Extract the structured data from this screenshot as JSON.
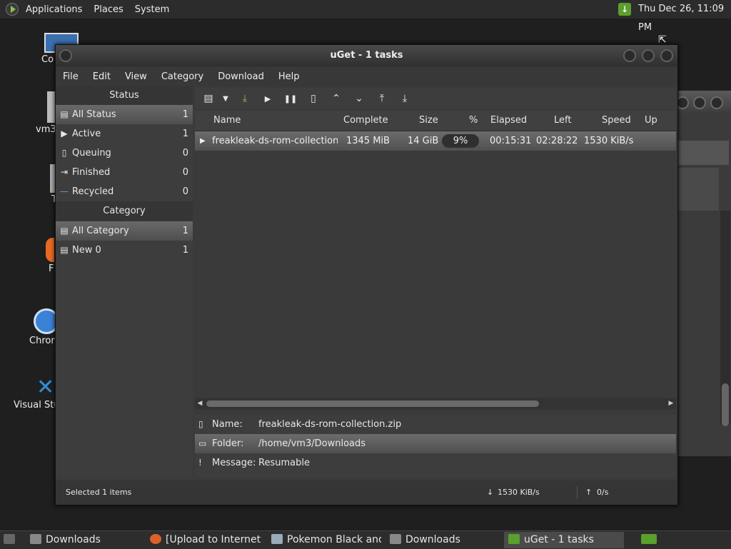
{
  "top_panel": {
    "menus": [
      "Applications",
      "Places",
      "System"
    ],
    "clock": "Thu Dec 26, 11:09 PM",
    "colors": {
      "tray_accent": "#5aa02c"
    }
  },
  "desktop_icons": [
    "Co",
    "vm3",
    "T",
    "F",
    "Chror",
    "Visual Stu"
  ],
  "window": {
    "title": "uGet - 1 tasks",
    "menu": [
      "File",
      "Edit",
      "View",
      "Category",
      "Download",
      "Help"
    ]
  },
  "sidebar": {
    "status_header": "Status",
    "status_items": [
      {
        "label": "All Status",
        "count": "1",
        "icon": "all-status-icon"
      },
      {
        "label": "Active",
        "count": "1",
        "icon": "play-icon"
      },
      {
        "label": "Queuing",
        "count": "0",
        "icon": "document-icon"
      },
      {
        "label": "Finished",
        "count": "0",
        "icon": "finished-icon"
      },
      {
        "label": "Recycled",
        "count": "0",
        "icon": "minus-icon"
      }
    ],
    "category_header": "Category",
    "category_items": [
      {
        "label": "All Category",
        "count": "1",
        "icon": "category-icon"
      },
      {
        "label": "New 0",
        "count": "1",
        "icon": "category-icon"
      }
    ]
  },
  "toolbar": {
    "icons": [
      "new-download-icon",
      "dropdown-icon",
      "batch-download-icon",
      "start-icon",
      "pause-icon",
      "properties-icon",
      "move-up-icon",
      "move-down-icon",
      "move-top-icon",
      "move-bottom-icon"
    ]
  },
  "task_list": {
    "columns": {
      "name": "Name",
      "complete": "Complete",
      "size": "Size",
      "percent": "%",
      "elapsed": "Elapsed",
      "left": "Left",
      "speed": "Speed",
      "up_speed": "Up Spe"
    },
    "rows": [
      {
        "name": "freakleak-ds-rom-collection.",
        "complete": "1345 MiB",
        "size": "14 GiB",
        "percent": "9%",
        "elapsed": "00:15:31",
        "left": "02:28:22",
        "speed": "1530 KiB/s"
      }
    ]
  },
  "detail": {
    "name_label": "Name:",
    "name_value": "freakleak-ds-rom-collection.zip",
    "folder_label": "Folder:",
    "folder_value": "/home/vm3/Downloads",
    "message_label": "Message:",
    "message_value": "Resumable"
  },
  "statusbar": {
    "selected": "Selected 1 items",
    "down_speed": "1530 KiB/s",
    "up_speed": "0/s"
  },
  "taskbar": {
    "items": [
      "Downloads",
      "[Upload to Internet ...",
      "Pokemon Black and...",
      "Downloads",
      "uGet - 1 tasks"
    ]
  }
}
